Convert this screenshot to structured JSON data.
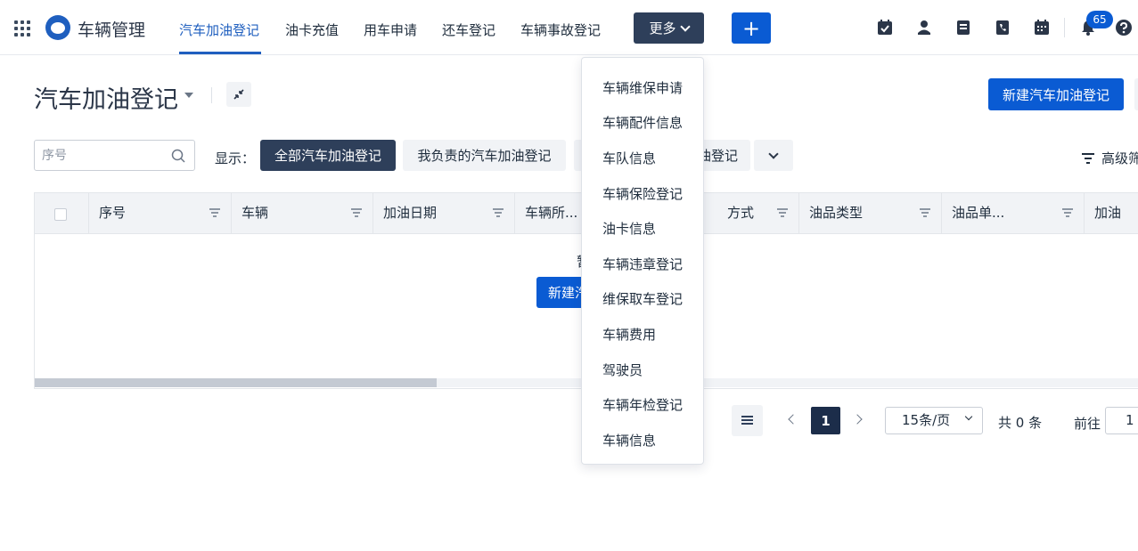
{
  "app": {
    "title": "车辆管理"
  },
  "nav": {
    "items": [
      {
        "label": "汽车加油登记",
        "active": true
      },
      {
        "label": "油卡充值",
        "active": false
      },
      {
        "label": "用车申请",
        "active": false
      },
      {
        "label": "还车登记",
        "active": false
      },
      {
        "label": "车辆事故登记",
        "active": false
      }
    ],
    "more_label": "更多",
    "plus_label": "+"
  },
  "toolbar": {
    "icons": [
      "task-check-icon",
      "contact-icon",
      "note-icon",
      "phone-book-icon",
      "calendar-icon",
      "bell-icon",
      "help-icon"
    ],
    "notification_count": "65"
  },
  "page": {
    "title": "汽车加油登记",
    "new_button_label": "新建汽车加油登记"
  },
  "filters": {
    "search_placeholder": "序号",
    "show_label": "显示：",
    "tabs": [
      {
        "label": "全部汽车加油登记",
        "active": true
      },
      {
        "label": "我负责的汽车加油登记",
        "active": false
      },
      {
        "label": "油登记",
        "active": false
      }
    ],
    "advanced_label": "高级筛"
  },
  "table": {
    "columns": [
      "序号",
      "车辆",
      "加油日期",
      "车辆所...",
      "方式",
      "油品类型",
      "油品单...",
      "加油"
    ],
    "empty_text": "暂",
    "empty_button_label": "新建汽车加油登记"
  },
  "pagination": {
    "current_page": "1",
    "page_size": "15条/页",
    "total": "共 0 条",
    "goto_label": "前往",
    "goto_value": "1"
  },
  "more_menu": {
    "items": [
      "车辆维保申请",
      "车辆配件信息",
      "车队信息",
      "车辆保险登记",
      "油卡信息",
      "车辆违章登记",
      "维保取车登记",
      "车辆费用",
      "驾驶员",
      "车辆年检登记",
      "车辆信息"
    ]
  },
  "colors": {
    "primary": "#0a5bd3",
    "dark": "#2e3f5a",
    "accent_text": "#1f5fbf"
  }
}
